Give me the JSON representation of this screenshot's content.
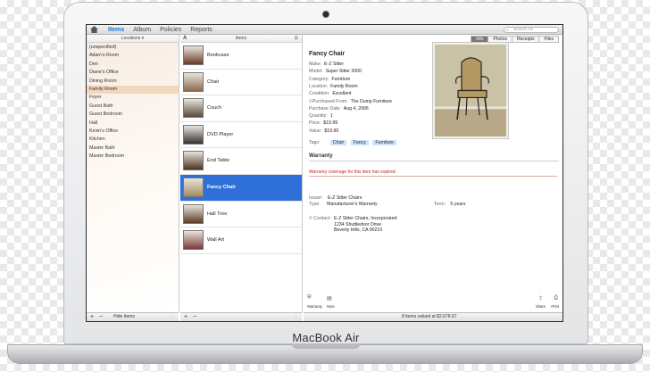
{
  "laptop": {
    "brand": "MacBook Air"
  },
  "tabs": [
    "Items",
    "Album",
    "Policies",
    "Reports"
  ],
  "active_tab": 0,
  "search": {
    "placeholder": "Search All"
  },
  "locations": {
    "header": "Locations",
    "items": [
      "(unspecified)",
      "Adam's Room",
      "Den",
      "Diane's Office",
      "Dining Room",
      "Family Room",
      "Foyer",
      "Guest Bath",
      "Guest Bedroom",
      "Hall",
      "Kevin's Office",
      "Kitchen",
      "Master Bath",
      "Master Bedroom"
    ],
    "selected": 5,
    "footer_button": "Hide Items"
  },
  "items": {
    "header": "Items",
    "sort_label": "A",
    "rows": [
      {
        "name": "Bookcase",
        "thumb": "#6b3a26"
      },
      {
        "name": "Chair",
        "thumb": "#8a6b4c"
      },
      {
        "name": "Couch",
        "thumb": "#5a4a3c"
      },
      {
        "name": "DVD Player",
        "thumb": "#333333"
      },
      {
        "name": "End Table",
        "thumb": "#4a3322"
      },
      {
        "name": "Fancy Chair",
        "thumb": "#a48c5f"
      },
      {
        "name": "Hall Tree",
        "thumb": "#5c3b26"
      },
      {
        "name": "Wall Art",
        "thumb": "#7a3a3a"
      }
    ],
    "selected": 5
  },
  "detail": {
    "segments": [
      "Info",
      "Photos",
      "Receipts",
      "Files"
    ],
    "active_segment": 0,
    "title": "Fancy Chair",
    "fields": [
      {
        "label": "Make:",
        "value": "E-Z Sitter"
      },
      {
        "label": "Model:",
        "value": "Super Sitter 2000"
      },
      {
        "label": "Category:",
        "value": "Furniture"
      },
      {
        "label": "Location:",
        "value": "Family Room"
      },
      {
        "label": "Condition:",
        "value": "Excellent"
      },
      {
        "label": "Purchased From:",
        "value": "The Dump Furniture"
      },
      {
        "label": "Purchase Date:",
        "value": "Aug 4, 2006"
      },
      {
        "label": "Quantity:",
        "value": "1"
      },
      {
        "label": "Price:",
        "value": "$19.99"
      },
      {
        "label": "Value:",
        "value": "$19.99"
      }
    ],
    "tags_label": "Tags:",
    "tags": [
      "Chair",
      "Fancy",
      "Furniture"
    ],
    "warranty": {
      "heading": "Warranty",
      "notice": "Warranty coverage for this item has expired.",
      "issuer_label": "Issuer:",
      "issuer": "E-Z Sitter Chairs",
      "type_label": "Type:",
      "type": "Manufacturer's Warranty",
      "term_label": "Term:",
      "term": "5 years",
      "contact_label": "Contact:",
      "contact": [
        "E-Z Sitter Chairs, Incorporated",
        "1234 Shuttledoor Drive",
        "Beverly Hills, CA 90210"
      ]
    },
    "footer_buttons": [
      "Warranty",
      "Note",
      "Share",
      "Print"
    ],
    "summary": "8 items valued at $2,678.67"
  },
  "colors": {
    "accent": "#1f6fd6",
    "selection": "#2f6fd8",
    "location_selection": "#f2d7bd",
    "warning": "#c0261c"
  }
}
